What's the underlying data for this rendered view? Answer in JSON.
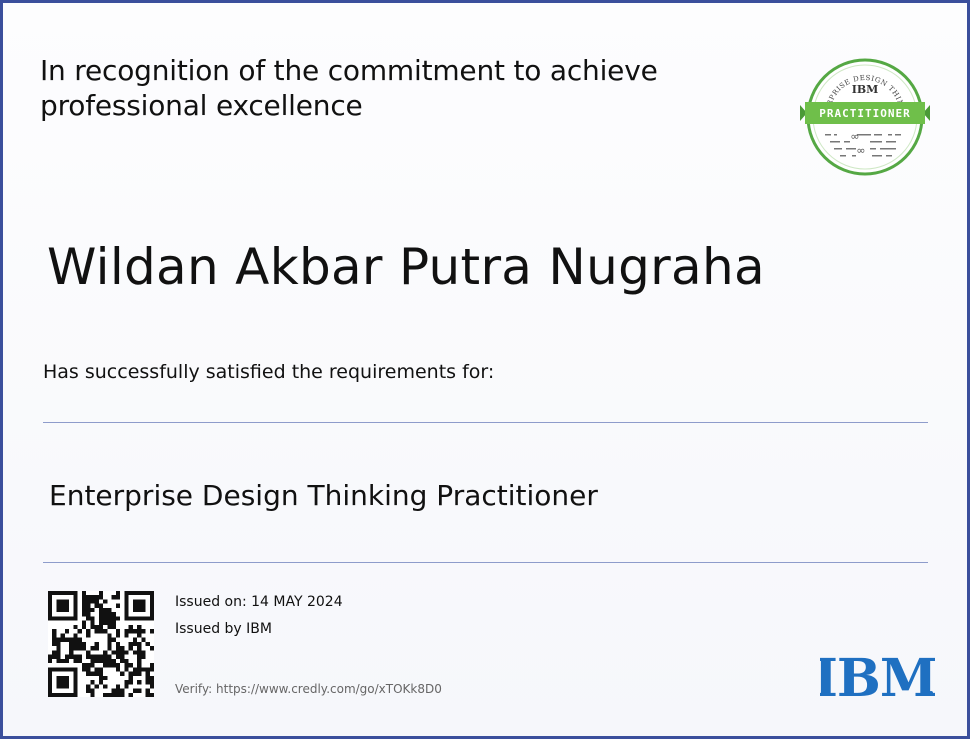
{
  "certificate": {
    "recognition": "In recognition of the commitment to achieve professional excellence",
    "recipient": "Wildan Akbar Putra Nugraha",
    "requirements": "Has successfully satisfied the requirements for:",
    "course": "Enterprise Design Thinking Practitioner",
    "issued_on": "Issued on: 14 MAY 2024",
    "issued_by": "Issued by IBM",
    "verify": "Verify: https://www.credly.com/go/xTOKk8D0"
  },
  "badge": {
    "arc_text": "ENTERPRISE DESIGN THINKING",
    "issuer": "IBM",
    "ribbon": "PRACTITIONER",
    "ring_color": "#55a844",
    "ribbon_color": "#6fbf4a"
  },
  "logo": {
    "text": "IBM",
    "color": "#1f70c1"
  },
  "colors": {
    "border": "#3b4f9c",
    "divider": "#8e9ccb"
  },
  "icons": [
    "qr-code-icon",
    "practitioner-badge-icon",
    "ibm-logo-icon"
  ]
}
